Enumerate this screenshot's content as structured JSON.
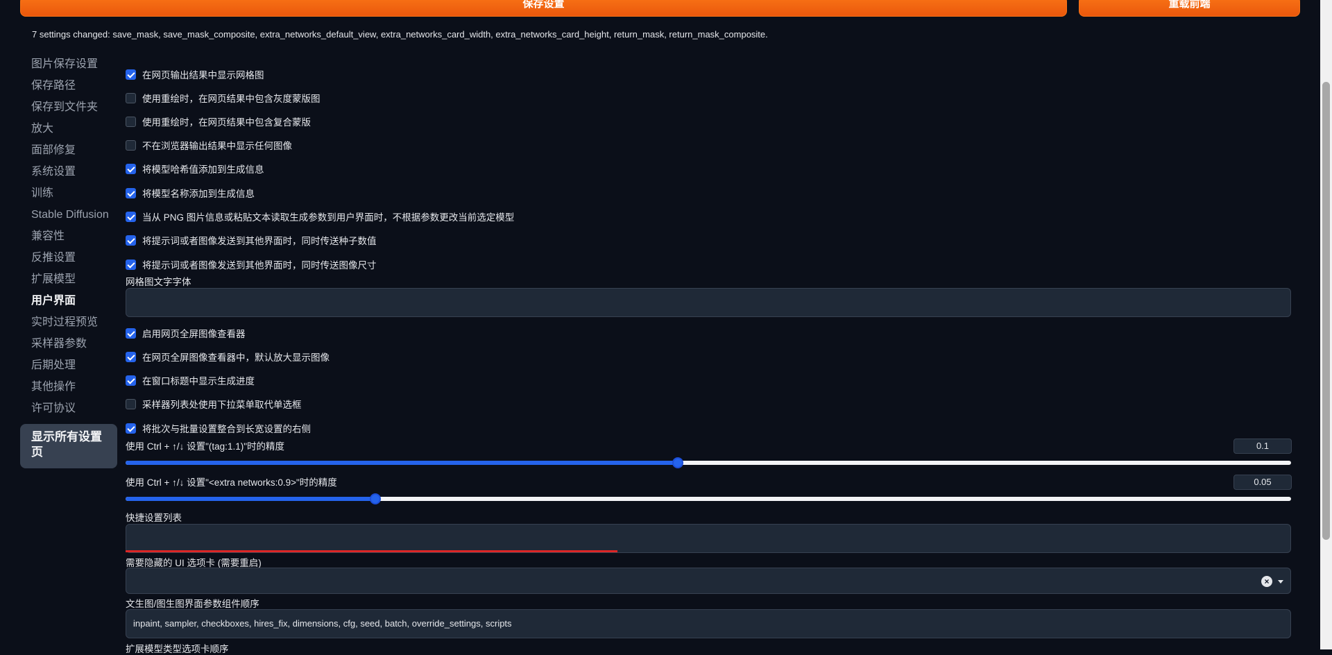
{
  "top_buttons": {
    "save_label": "保存设置",
    "reload_label": "重载前端"
  },
  "changed_message": "7 settings changed: save_mask, save_mask_composite, extra_networks_default_view, extra_networks_card_width, extra_networks_card_height, return_mask, return_mask_composite.",
  "sidebar": {
    "items": [
      {
        "label": "图片保存设置"
      },
      {
        "label": "保存路径"
      },
      {
        "label": "保存到文件夹"
      },
      {
        "label": "放大"
      },
      {
        "label": "面部修复"
      },
      {
        "label": "系统设置"
      },
      {
        "label": "训练"
      },
      {
        "label": "Stable Diffusion"
      },
      {
        "label": "兼容性"
      },
      {
        "label": "反推设置"
      },
      {
        "label": "扩展模型"
      },
      {
        "label": "用户界面"
      },
      {
        "label": "实时过程预览"
      },
      {
        "label": "采样器参数"
      },
      {
        "label": "后期处理"
      },
      {
        "label": "其他操作"
      },
      {
        "label": "许可协议"
      }
    ],
    "active": "用户界面",
    "show_all_label": "显示所有设置页"
  },
  "settings": {
    "checkboxes_a": [
      {
        "label": "在网页输出结果中显示网格图",
        "checked": true
      },
      {
        "label": "使用重绘时，在网页结果中包含灰度蒙版图",
        "checked": false
      },
      {
        "label": "使用重绘时，在网页结果中包含复合蒙版",
        "checked": false
      },
      {
        "label": "不在浏览器输出结果中显示任何图像",
        "checked": false
      },
      {
        "label": "将模型哈希值添加到生成信息",
        "checked": true
      },
      {
        "label": "将模型名称添加到生成信息",
        "checked": true
      },
      {
        "label": "当从 PNG 图片信息或粘贴文本读取生成参数到用户界面时，不根据参数更改当前选定模型",
        "checked": true
      },
      {
        "label": "将提示词或者图像发送到其他界面时，同时传送种子数值",
        "checked": true
      },
      {
        "label": "将提示词或者图像发送到其他界面时，同时传送图像尺寸",
        "checked": true
      }
    ],
    "grid_font_label": "网格图文字字体",
    "grid_font_value": "",
    "checkboxes_b": [
      {
        "label": "启用网页全屏图像查看器",
        "checked": true
      },
      {
        "label": "在网页全屏图像查看器中，默认放大显示图像",
        "checked": true
      },
      {
        "label": "在窗口标题中显示生成进度",
        "checked": true
      },
      {
        "label": "采样器列表处使用下拉菜单取代单选框",
        "checked": false
      },
      {
        "label": "将批次与批量设置整合到长宽设置的右侧",
        "checked": true
      }
    ],
    "slider1": {
      "label": "使用 Ctrl + ↑/↓ 设置\"(tag:1.1)\"时的精度",
      "value": "0.1",
      "fraction": 0.474
    },
    "slider2": {
      "label": "使用 Ctrl + ↑/↓ 设置\"<extra networks:0.9>\"时的精度",
      "value": "0.05",
      "fraction": 0.214
    },
    "quick_settings": {
      "label": "快捷设置列表",
      "value": "",
      "progress_fraction": 0.422,
      "progress_color": "#dc2626"
    },
    "hidden_tabs": {
      "label": "需要隐藏的 UI 选项卡 (需要重启)",
      "value": "",
      "clear_icon": "×"
    },
    "ui_order": {
      "label": "文生图/图生图界面参数组件顺序",
      "value": "inpaint, sampler, checkboxes, hires_fix, dimensions, cfg, seed, batch, override_settings, scripts"
    },
    "extra_tabs_order_label": "扩展模型类型选项卡顺序"
  },
  "colors": {
    "accent": "#f97316",
    "checkbox": "#2563eb",
    "background": "#0b0f19"
  }
}
